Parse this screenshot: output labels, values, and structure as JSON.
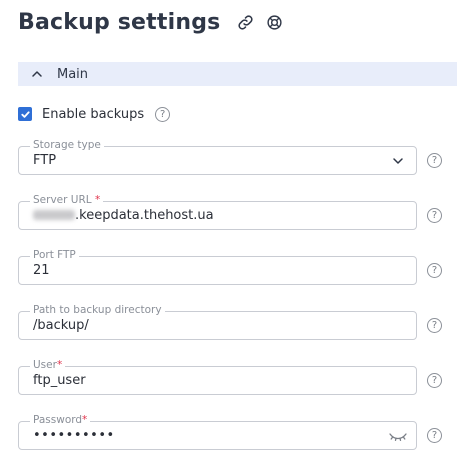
{
  "header": {
    "title": "Backup settings",
    "link_icon": "link-icon",
    "support_icon": "lifebuoy-icon"
  },
  "section": {
    "label": "Main",
    "expanded": true
  },
  "enable_backups": {
    "label": "Enable backups",
    "checked": true
  },
  "fields": {
    "storage_type": {
      "label": "Storage type",
      "value": "FTP",
      "required": false
    },
    "server_url": {
      "label": "Server URL",
      "required_mark": "*",
      "value": ".keepdata.thehost.ua"
    },
    "port": {
      "label": "Port FTP",
      "value": "21"
    },
    "path": {
      "label": "Path to backup directory",
      "value": "/backup/"
    },
    "user": {
      "label": "User",
      "required_mark": "*",
      "value": "ftp_user"
    },
    "password": {
      "label": "Password",
      "required_mark": "*",
      "value": "••••••••••"
    }
  },
  "help_glyph": "?",
  "colors": {
    "accent": "#2f6fd6",
    "section_bg": "#e8edfa",
    "required": "#e0324b",
    "border": "#c9ccd3"
  }
}
